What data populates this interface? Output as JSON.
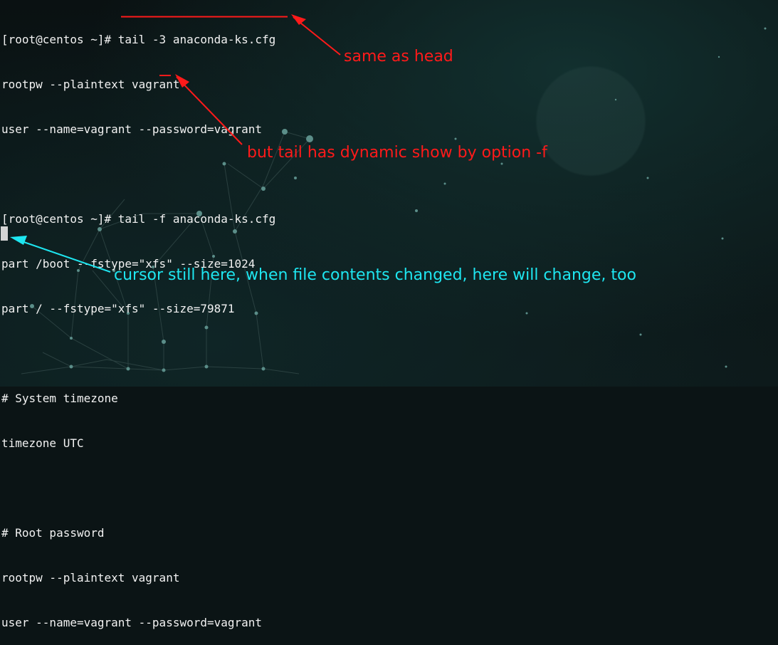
{
  "terminal": {
    "lines": [
      "[root@centos ~]# tail -3 anaconda-ks.cfg",
      "rootpw --plaintext vagrant",
      "user --name=vagrant --password=vagrant",
      "",
      "[root@centos ~]# tail -f anaconda-ks.cfg",
      "part /boot --fstype=\"xfs\" --size=1024",
      "part / --fstype=\"xfs\" --size=79871",
      "",
      "# System timezone",
      "timezone UTC",
      "",
      "# Root password",
      "rootpw --plaintext vagrant",
      "user --name=vagrant --password=vagrant"
    ]
  },
  "annotations": {
    "same_as_head": "same as head",
    "dynamic_show": "but tail has dynamic show by option -f",
    "cursor_note": "cursor still here, when file contents changed, here will change, too"
  },
  "colors": {
    "annotation_red": "#ff1a1a",
    "annotation_cyan": "#1ee6f0",
    "terminal_text": "#f2f2f2",
    "background": "#0b1415"
  }
}
